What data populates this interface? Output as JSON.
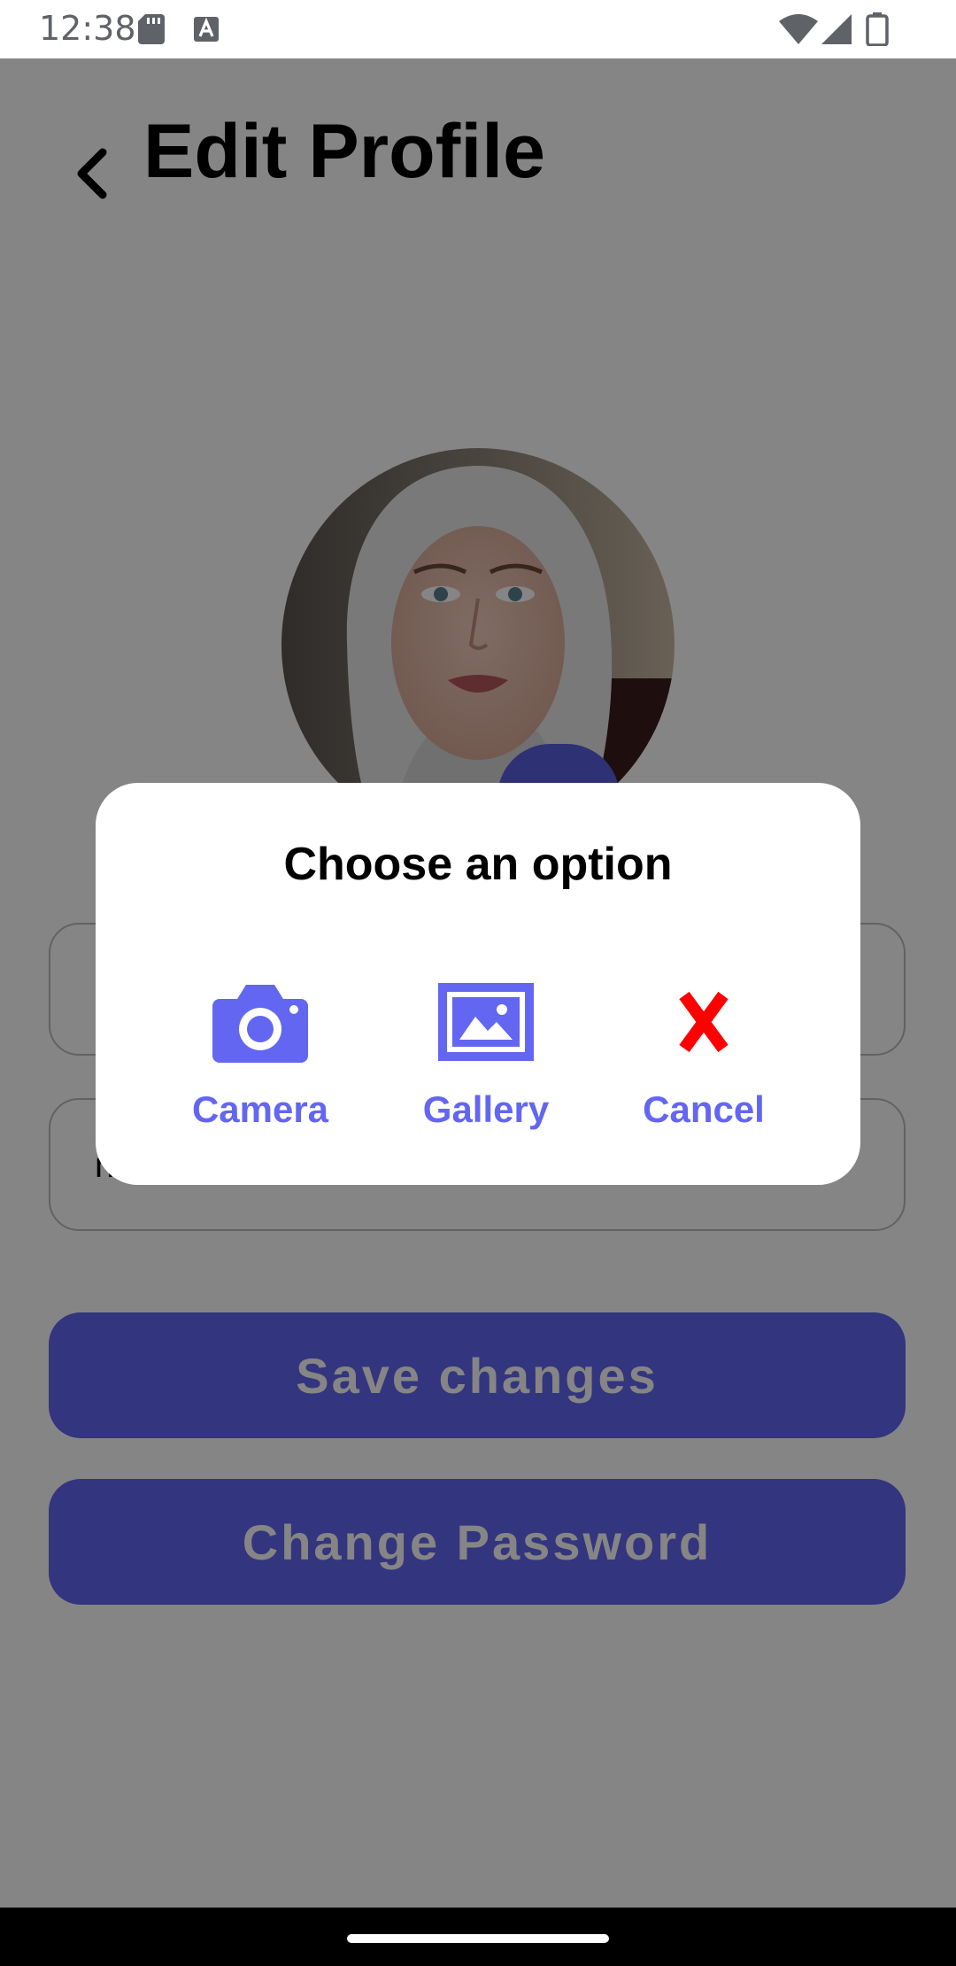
{
  "status_bar": {
    "time": "12:38",
    "icons": [
      "sd-card-icon",
      "a-badge-icon",
      "wifi-icon",
      "signal-icon",
      "battery-icon"
    ]
  },
  "header": {
    "title": "Edit Profile",
    "back_icon": "chevron-left-icon"
  },
  "profile": {
    "avatar_icon": "profile-photo",
    "edit_icon": "camera-icon"
  },
  "form": {
    "field2_partial_text": "n"
  },
  "buttons": {
    "save_label": "Save changes",
    "change_password_label": "Change Password"
  },
  "dialog": {
    "title": "Choose an option",
    "options": [
      {
        "label": "Camera",
        "icon": "camera-icon"
      },
      {
        "label": "Gallery",
        "icon": "image-icon"
      },
      {
        "label": "Cancel",
        "icon": "close-icon"
      }
    ]
  },
  "colors": {
    "accent": "#6366f1",
    "cancel": "#ff0000",
    "scrim": "rgba(0,0,0,0.48)"
  }
}
